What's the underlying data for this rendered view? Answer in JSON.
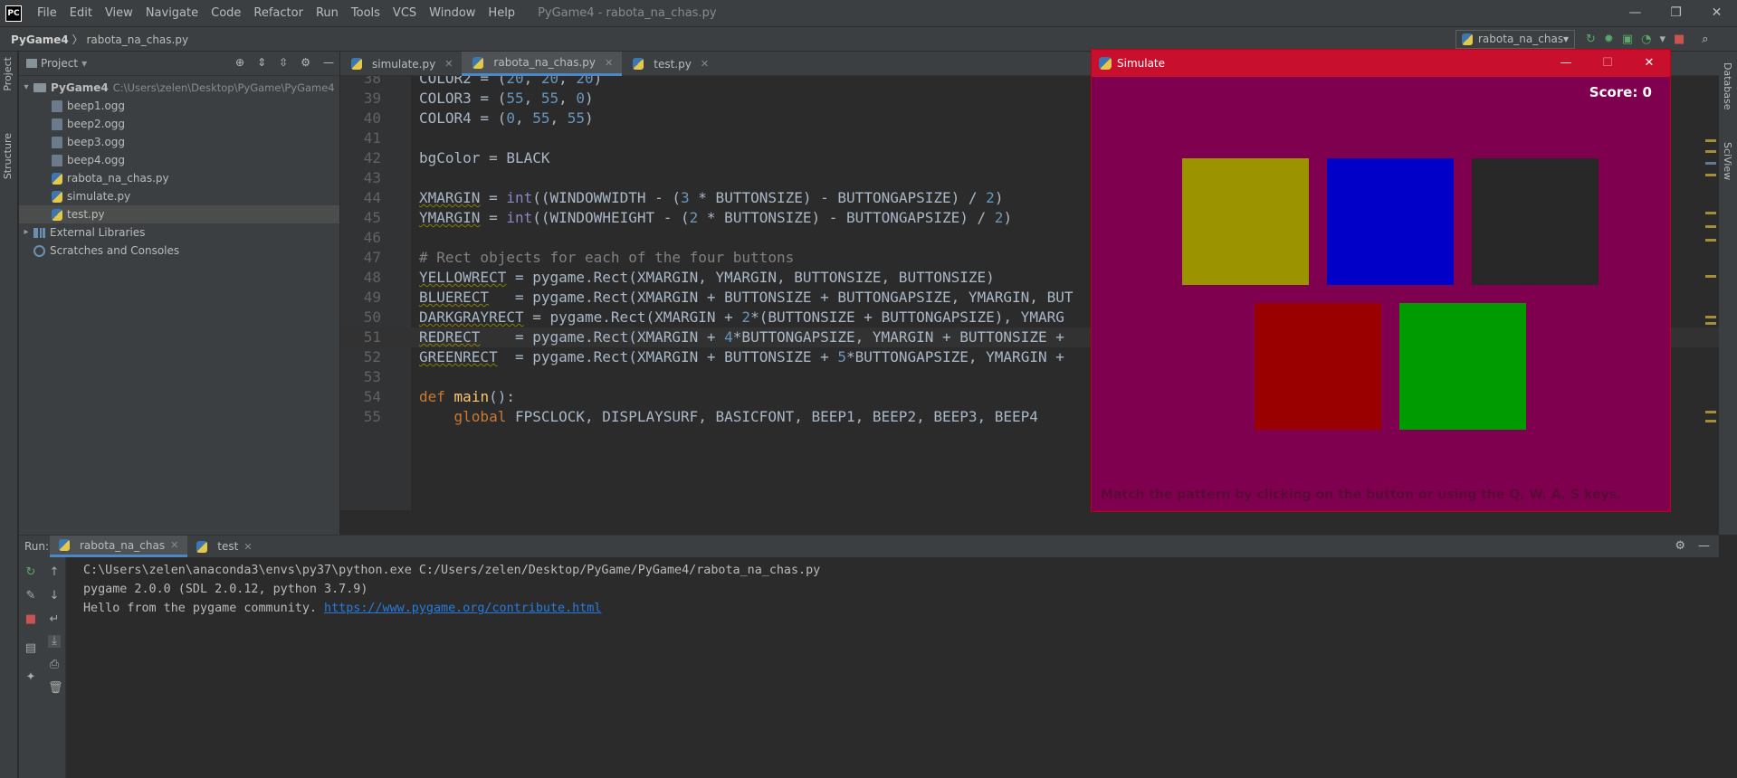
{
  "app": {
    "logo_text": "PC",
    "window_title": "PyGame4 - rabota_na_chas.py",
    "menu": [
      "File",
      "Edit",
      "View",
      "Navigate",
      "Code",
      "Refactor",
      "Run",
      "Tools",
      "VCS",
      "Window",
      "Help"
    ],
    "window_controls": [
      "—",
      "❐",
      "✕"
    ]
  },
  "navbar": {
    "project": "PyGame4",
    "separator": "〉",
    "file": "rabota_na_chas.py",
    "run_config": "rabota_na_chas"
  },
  "side_tabs": {
    "project": "Project",
    "structure": "Structure",
    "database": "Database",
    "sciview": "SciView"
  },
  "project_panel": {
    "title": "Project",
    "root": {
      "name": "PyGame4",
      "path": "C:\\Users\\zelen\\Desktop\\PyGame\\PyGame4"
    },
    "files": [
      "beep1.ogg",
      "beep2.ogg",
      "beep3.ogg",
      "beep4.ogg",
      "rabota_na_chas.py",
      "simulate.py",
      "test.py"
    ],
    "selected": "test.py",
    "external": "External Libraries",
    "scratches": "Scratches and Consoles"
  },
  "editor_tabs": [
    {
      "label": "simulate.py",
      "active": false
    },
    {
      "label": "rabota_na_chas.py",
      "active": true
    },
    {
      "label": "test.py",
      "active": false
    }
  ],
  "code_lines": [
    {
      "n": "38",
      "html": "COLOR2 = (<span class='num'>20</span>, <span class='num'>20</span>, <span class='num'>20</span>)"
    },
    {
      "n": "39",
      "html": "COLOR3 = (<span class='num'>55</span>, <span class='num'>55</span>, <span class='num'>0</span>)"
    },
    {
      "n": "40",
      "html": "COLOR4 = (<span class='num'>0</span>, <span class='num'>55</span>, <span class='num'>55</span>)"
    },
    {
      "n": "41",
      "html": ""
    },
    {
      "n": "42",
      "html": "bgColor = BLACK"
    },
    {
      "n": "43",
      "html": ""
    },
    {
      "n": "44",
      "html": "<span class='ul'>XMARGIN</span> = <span class='bi'>int</span>((WINDOWWIDTH - (<span class='num'>3</span> * BUTTONSIZE) - BUTTONGAPSIZE) / <span class='num'>2</span>)"
    },
    {
      "n": "45",
      "html": "<span class='ul'>YMARGIN</span> = <span class='bi'>int</span>((WINDOWHEIGHT - (<span class='num'>2</span> * BUTTONSIZE) - BUTTONGAPSIZE) / <span class='num'>2</span>)"
    },
    {
      "n": "46",
      "html": ""
    },
    {
      "n": "47",
      "html": "<span class='cm'># Rect objects for each of the four buttons</span>"
    },
    {
      "n": "48",
      "html": "<span class='ul'>YELLOWRECT</span> = pygame.Rect(XMARGIN, YMARGIN, BUTTONSIZE, BUTTONSIZE)"
    },
    {
      "n": "49",
      "html": "<span class='ul'>BLUERECT</span>   = pygame.Rect(XMARGIN + BUTTONSIZE + BUTTONGAPSIZE, YMARGIN, BUT"
    },
    {
      "n": "50",
      "html": "<span class='ul'>DARKGRAYRECT</span> = pygame.Rect(XMARGIN + <span class='num'>2</span>*(BUTTONSIZE + BUTTONGAPSIZE), YMARG"
    },
    {
      "n": "51",
      "html": "<span class='ul'>REDRECT</span>    = pygame.Rect(XMARGIN + <span class='num'>4</span>*BUTTONGAPSIZE, YMARGIN + BUTTONSIZE +"
    },
    {
      "n": "52",
      "html": "<span class='ul'>GREENRECT</span>  = pygame.Rect(XMARGIN + BUTTONSIZE + <span class='num'>5</span>*BUTTONGAPSIZE, YMARGIN +"
    },
    {
      "n": "53",
      "html": ""
    },
    {
      "n": "54",
      "html": "<span class='kw'>def</span> <span class='fn'>main</span>():"
    },
    {
      "n": "55",
      "html": "    <span class='kw'>global</span> FPSCLOCK, DISPLAYSURF, BASICFONT, BEEP1, BEEP2, BEEP3, BEEP4"
    }
  ],
  "current_line": "51",
  "simulate_window": {
    "title": "Simulate",
    "score": "Score: 0",
    "hint": "Match the pattern by clicking on the button or using the Q, W, A, S keys.",
    "bg_color": "#800050",
    "buttons": [
      {
        "name": "yellow",
        "color": "#9b9400"
      },
      {
        "name": "blue",
        "color": "#0000c8"
      },
      {
        "name": "darkgray",
        "color": "#282828"
      },
      {
        "name": "red",
        "color": "#9b0000"
      },
      {
        "name": "green",
        "color": "#009b00"
      }
    ]
  },
  "run_panel": {
    "label": "Run:",
    "tabs": [
      {
        "label": "rabota_na_chas",
        "active": true
      },
      {
        "label": "test",
        "active": false
      }
    ],
    "console": [
      "C:\\Users\\zelen\\anaconda3\\envs\\py37\\python.exe C:/Users/zelen/Desktop/PyGame/PyGame4/rabota_na_chas.py",
      "pygame 2.0.0 (SDL 2.0.12, python 3.7.9)"
    ],
    "hello_text": "Hello from the pygame community. ",
    "hello_link": "https://www.pygame.org/contribute.html"
  }
}
